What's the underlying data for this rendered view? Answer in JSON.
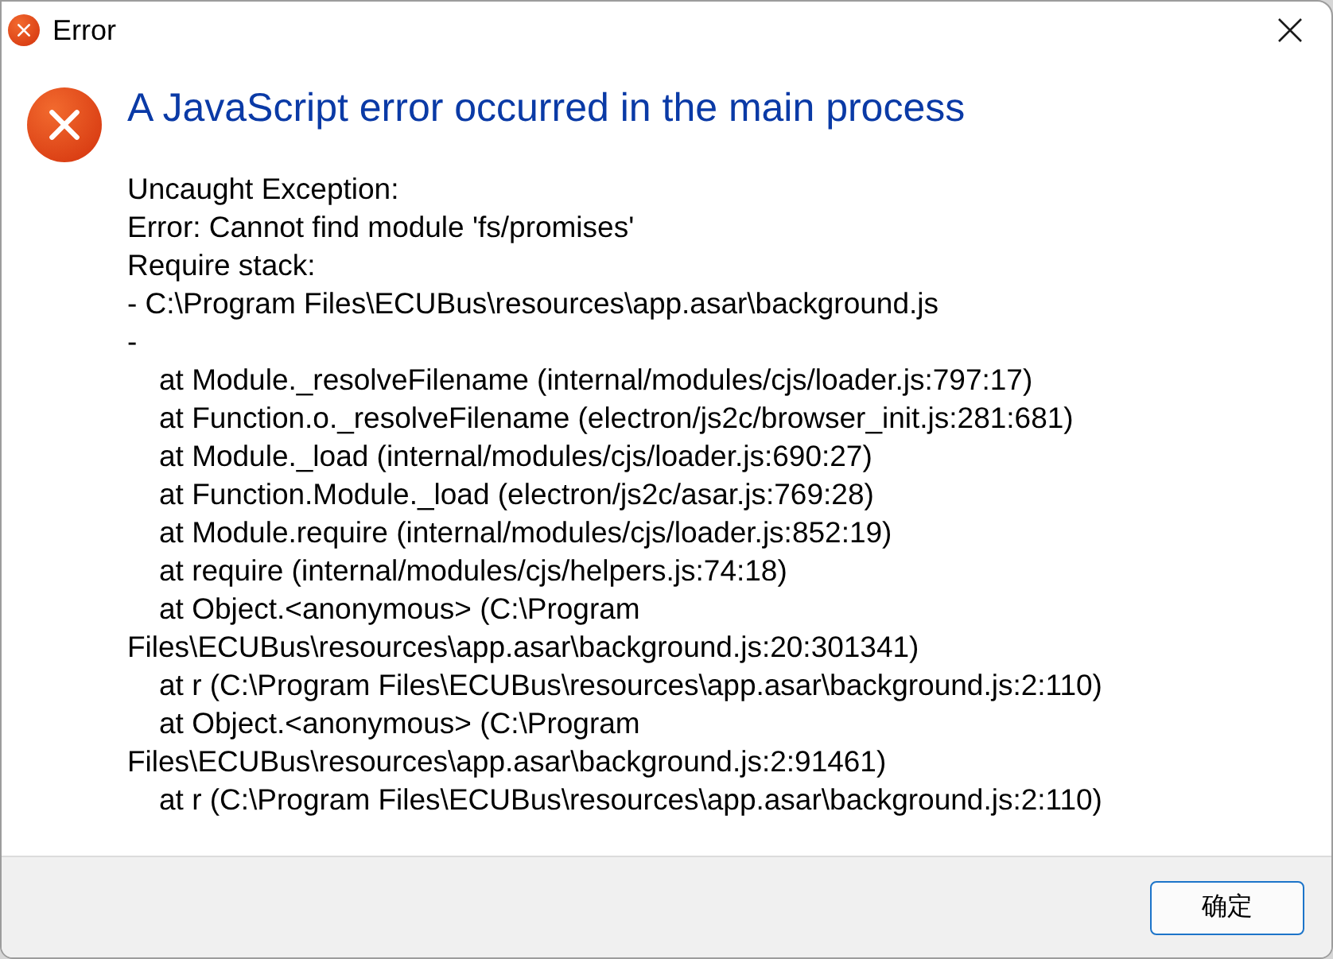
{
  "window": {
    "title": "Error"
  },
  "message": {
    "heading": "A JavaScript error occurred in the main process",
    "lines": [
      {
        "text": "Uncaught Exception:",
        "indent": false
      },
      {
        "text": "Error: Cannot find module 'fs/promises'",
        "indent": false
      },
      {
        "text": "Require stack:",
        "indent": false
      },
      {
        "text": "- C:\\Program Files\\ECUBus\\resources\\app.asar\\background.js",
        "indent": false
      },
      {
        "text": "-",
        "indent": false
      },
      {
        "text": "at Module._resolveFilename (internal/modules/cjs/loader.js:797:17)",
        "indent": true
      },
      {
        "text": "at Function.o._resolveFilename (electron/js2c/browser_init.js:281:681)",
        "indent": true
      },
      {
        "text": "at Module._load (internal/modules/cjs/loader.js:690:27)",
        "indent": true
      },
      {
        "text": "at Function.Module._load (electron/js2c/asar.js:769:28)",
        "indent": true
      },
      {
        "text": "at Module.require (internal/modules/cjs/loader.js:852:19)",
        "indent": true
      },
      {
        "text": "at require (internal/modules/cjs/helpers.js:74:18)",
        "indent": true
      },
      {
        "text": "at Object.<anonymous> (C:\\Program",
        "indent": true
      },
      {
        "text": "Files\\ECUBus\\resources\\app.asar\\background.js:20:301341)",
        "indent": false
      },
      {
        "text": "at r (C:\\Program Files\\ECUBus\\resources\\app.asar\\background.js:2:110)",
        "indent": true
      },
      {
        "text": "at Object.<anonymous> (C:\\Program",
        "indent": true
      },
      {
        "text": "Files\\ECUBus\\resources\\app.asar\\background.js:2:91461)",
        "indent": false
      },
      {
        "text": "at r (C:\\Program Files\\ECUBus\\resources\\app.asar\\background.js:2:110)",
        "indent": true
      }
    ]
  },
  "buttons": [
    {
      "label": "确定",
      "default": true
    }
  ]
}
